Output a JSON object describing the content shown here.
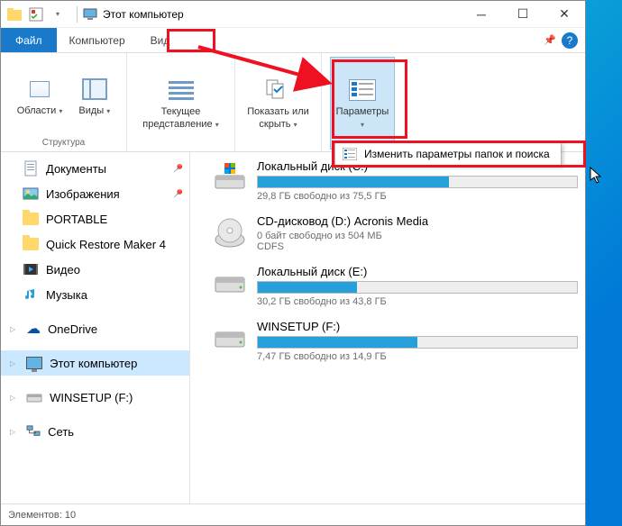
{
  "title": "Этот компьютер",
  "tabs": {
    "file": "Файл",
    "computer": "Компьютер",
    "view": "Вид"
  },
  "ribbon": {
    "areas": "Области",
    "views": "Виды",
    "structure": "Структура",
    "current_view": "Текущее представление",
    "show_hide": "Показать или скрыть",
    "options": "Параметры"
  },
  "dropdown": {
    "change_options": "Изменить параметры папок и поиска"
  },
  "sidebar": {
    "documents": "Документы",
    "images": "Изображения",
    "portable": "PORTABLE",
    "qrm": "Quick Restore Maker 4",
    "video": "Видео",
    "music": "Музыка",
    "onedrive": "OneDrive",
    "this_pc": "Этот компьютер",
    "winsetup": "WINSETUP (F:)",
    "network": "Сеть"
  },
  "drives": [
    {
      "name": "Локальный диск (C:)",
      "info": "29,8 ГБ свободно из 75,5 ГБ",
      "fill": 60
    },
    {
      "name": "CD-дисковод (D:) Acronis Media",
      "info": "0 байт свободно из 504 МБ",
      "fs": "CDFS",
      "fill": 0,
      "type": "cd"
    },
    {
      "name": "Локальный диск (E:)",
      "info": "30,2 ГБ свободно из 43,8 ГБ",
      "fill": 31
    },
    {
      "name": "WINSETUP (F:)",
      "info": "7,47 ГБ свободно из 14,9 ГБ",
      "fill": 50
    }
  ],
  "status": {
    "elements_label": "Элементов:",
    "elements_count": "10"
  }
}
